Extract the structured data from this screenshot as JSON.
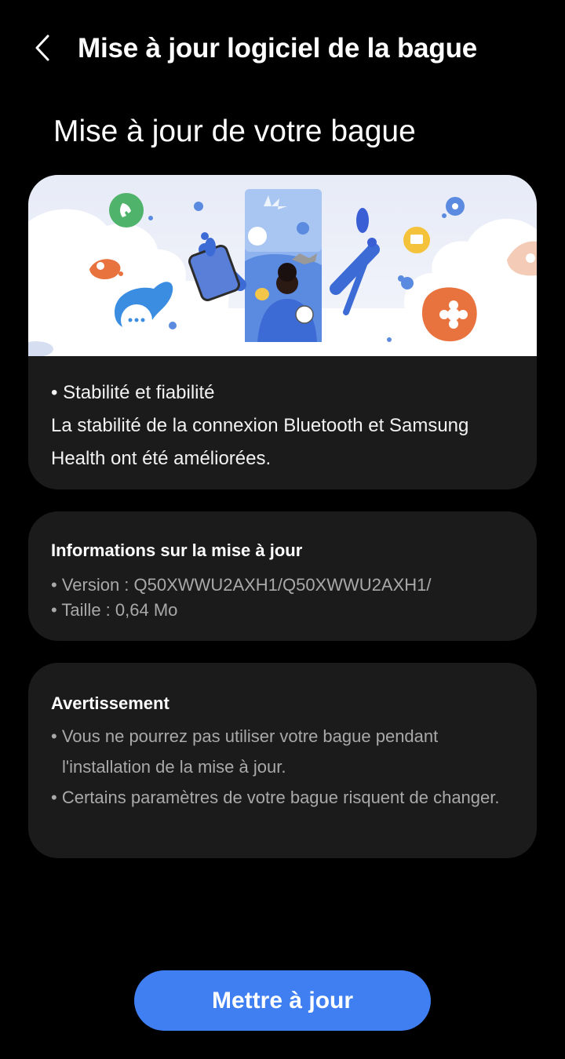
{
  "header": {
    "title": "Mise à jour logiciel de la bague",
    "back_icon": "chevron-left-icon"
  },
  "page_heading": "Mise à jour de votre bague",
  "hero": {
    "illustration": "ring-update-illustration",
    "bullet_title": "• Stabilité et fiabilité",
    "description": "La stabilité de la connexion Bluetooth et Samsung Health ont été améliorées."
  },
  "update_info": {
    "title": "Informations sur la mise à jour",
    "version": "• Version : Q50XWWU2AXH1/Q50XWWU2AXH1/",
    "size": "• Taille : 0,64 Mo"
  },
  "warning": {
    "title": "Avertissement",
    "items": [
      "• Vous ne pourrez pas utiliser votre bague pendant l'installation de la mise à jour.",
      "• Certains paramètres de votre bague risquent de changer."
    ]
  },
  "actions": {
    "update_label": "Mettre à jour"
  },
  "colors": {
    "background": "#000000",
    "card": "#1b1b1b",
    "accent": "#3f7ff2",
    "secondary_text": "#a9a9a9"
  }
}
